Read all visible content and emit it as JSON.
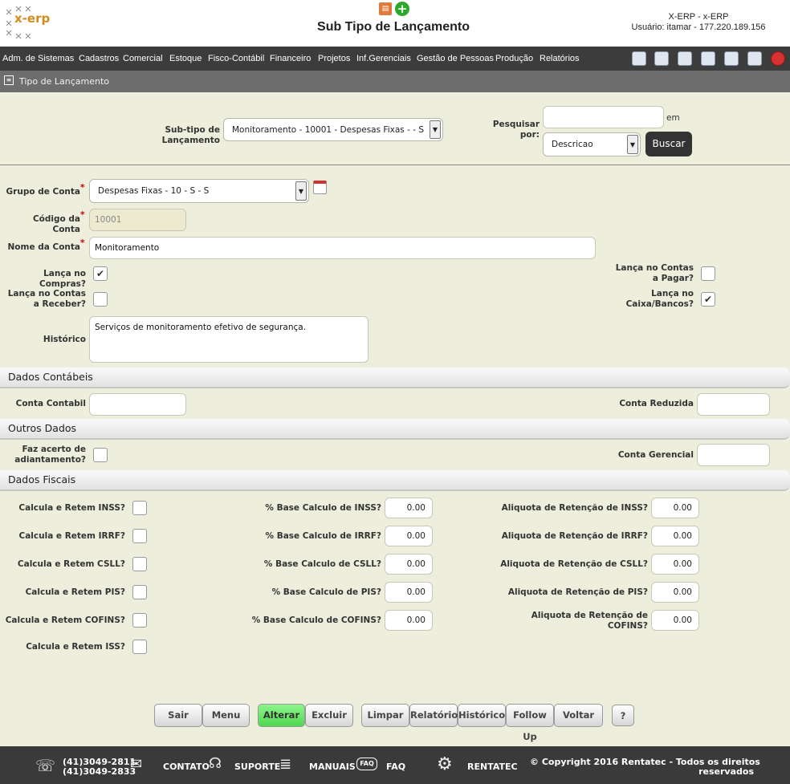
{
  "header": {
    "logo_text": "x-erp",
    "title": "Sub Tipo de Lançamento",
    "system_name": "X-ERP - x-ERP",
    "user_info": "Usuário: itamar - 177.220.189.156"
  },
  "menu": [
    "Adm. de Sistemas",
    "Cadastros",
    "Comercial",
    "Estoque",
    "Fisco-Contábil",
    "Financeiro",
    "Projetos",
    "Inf.Gerenciais",
    "Gestão de Pessoas",
    "Produção",
    "Relatórios"
  ],
  "breadcrumb": "Tipo de Lançamento",
  "search": {
    "subtipo_label": "Sub-tipo de Lançamento",
    "subtipo_value": "Monitoramento - 10001 - Despesas Fixas - - S",
    "pesquisar_label": "Pesquisar por:",
    "em_label": "em",
    "search_value": "",
    "field_value": "Descricao",
    "buscar_label": "Buscar"
  },
  "form": {
    "grupo_label": "Grupo de Conta",
    "grupo_value": "Despesas Fixas - 10 - S - S",
    "codigo_label": "Código da Conta",
    "codigo_value": "10001",
    "nome_label": "Nome da Conta",
    "nome_value": "Monitoramento",
    "compras_label": "Lança no Compras?",
    "compras_checked": true,
    "receber_label": "Lança no Contas a Receber?",
    "receber_checked": false,
    "pagar_label": "Lança no Contas a Pagar?",
    "pagar_checked": false,
    "caixa_label": "Lança no Caixa/Bancos?",
    "caixa_checked": true,
    "historico_label": "Histórico",
    "historico_value": "Serviços de monitoramento efetivo de segurança.",
    "required_mark": "*"
  },
  "dados_contabeis": {
    "title": "Dados Contábeis",
    "conta_contabil_label": "Conta Contabil",
    "conta_contabil_value": "",
    "conta_reduzida_label": "Conta Reduzida",
    "conta_reduzida_value": ""
  },
  "outros_dados": {
    "title": "Outros Dados",
    "acerto_label": "Faz acerto de adiantamento?",
    "acerto_checked": false,
    "conta_gerencial_label": "Conta Gerencial",
    "conta_gerencial_value": ""
  },
  "dados_fiscais": {
    "title": "Dados Fiscais",
    "rows": [
      {
        "calc_label": "Calcula e Retem INSS?",
        "base_label": "% Base Calculo de INSS?",
        "base_value": "0.00",
        "aliq_label": "Aliquota de Retenção de INSS?",
        "aliq_value": "0.00"
      },
      {
        "calc_label": "Calcula e Retem IRRF?",
        "base_label": "% Base Calculo de IRRF?",
        "base_value": "0.00",
        "aliq_label": "Aliquota de Retenção de IRRF?",
        "aliq_value": "0.00"
      },
      {
        "calc_label": "Calcula e Retem CSLL?",
        "base_label": "% Base Calculo de CSLL?",
        "base_value": "0.00",
        "aliq_label": "Aliquota de Retenção de CSLL?",
        "aliq_value": "0.00"
      },
      {
        "calc_label": "Calcula e Retem PIS?",
        "base_label": "% Base Calculo de PIS?",
        "base_value": "0.00",
        "aliq_label": "Aliquota de Retenção de PIS?",
        "aliq_value": "0.00"
      },
      {
        "calc_label": "Calcula e Retem COFINS?",
        "base_label": "% Base Calculo de COFINS?",
        "base_value": "0.00",
        "aliq_label": "Aliquota de Retenção de COFINS?",
        "aliq_value": "0.00"
      }
    ],
    "iss_label": "Calcula e Retem ISS?"
  },
  "actions": {
    "sair": "Sair",
    "menu": "Menu",
    "alterar": "Alterar",
    "excluir": "Excluir",
    "limpar": "Limpar",
    "relatorio": "Relatório",
    "historico": "Histórico",
    "followup": "Follow Up",
    "voltar": "Voltar",
    "help": "?"
  },
  "footer": {
    "phone1": "(41)3049-2811",
    "phone2": "(41)3049-2833",
    "contato": "CONTATO",
    "suporte": "SUPORTE",
    "manuais": "MANUAIS",
    "faq_badge": "FAQ",
    "faq": "FAQ",
    "rentatec": "RENTATEC",
    "copyright1": "© Copyright 2016 Rentatec - Todos os direitos",
    "copyright2": "reservados"
  },
  "colors": {
    "accent_green": "#6ee86e",
    "menubar": "#3c3c3c",
    "body_bg": "#eeeedd"
  }
}
